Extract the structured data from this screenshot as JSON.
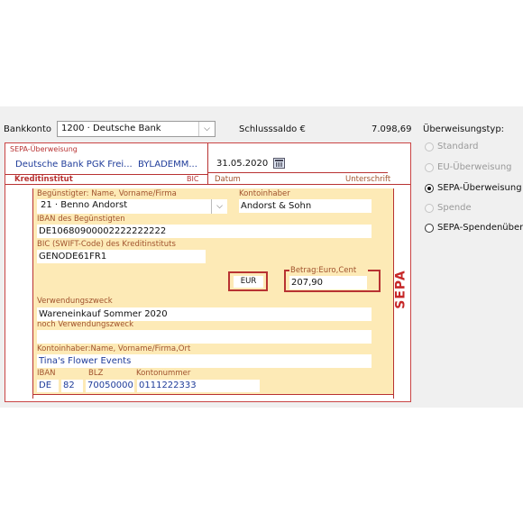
{
  "header": {
    "bankkonto_label": "Bankkonto",
    "bankkonto_value": "1200 · Deutsche Bank",
    "schlusssaldo_label": "Schlusssaldo €",
    "schlusssaldo_value": "7.098,69"
  },
  "form": {
    "sepa_title": "SEPA-Überweisung",
    "bank_name": "Deutsche Bank PGK Frei...",
    "bank_bic": "BYLADEMM...",
    "kreditinstitut_label": "Kreditinstitut",
    "bic_label": "BIC",
    "date_value": "31.05.2020",
    "datum_label": "Datum",
    "unterschrift_label": "Unterschrift",
    "beguenstigter_label": "Begünstigter: Name, Vorname/Firma",
    "beguenstigter_value": "21 · Benno Andorst",
    "kontoinhaber_label": "Kontoinhaber",
    "kontoinhaber_value": "Andorst & Sohn",
    "iban_label": "IBAN des Begünstigten",
    "iban_value": "DE10680900002222222222",
    "bic_field_label": "BIC (SWIFT-Code) des Kreditinstituts",
    "bic_value": "GENODE61FR1",
    "currency": "EUR",
    "betrag_label": "Betrag:Euro,Cent",
    "betrag_value": "207,90",
    "verwendungszweck_label": "Verwendungszweck",
    "verwendungszweck_value": "Wareneinkauf Sommer 2020",
    "noch_verwendungszweck_label": "noch Verwendungszweck",
    "noch_verwendungszweck_value": "",
    "kontoinhaber2_label": "Kontoinhaber:Name, Vorname/Firma,Ort",
    "kontoinhaber2_value": "Tina's Flower Events",
    "iban_col_label": "IBAN",
    "blz_col_label": "BLZ",
    "kontonummer_col_label": "Kontonummer",
    "iban_country": "DE",
    "iban_check": "82",
    "blz_value": "70050000",
    "kontonummer_value": "0111222333",
    "sepa_side": "SEPA"
  },
  "transfer_type": {
    "title": "Überweisungstyp:",
    "options": [
      {
        "label": "Standard",
        "selected": false,
        "enabled": false
      },
      {
        "label": "EU-Überweisung",
        "selected": false,
        "enabled": false
      },
      {
        "label": "SEPA-Überweisung",
        "selected": true,
        "enabled": true
      },
      {
        "label": "Spende",
        "selected": false,
        "enabled": false
      },
      {
        "label": "SEPA-Spendenüberw",
        "selected": false,
        "enabled": true
      }
    ]
  },
  "colors": {
    "accent_red": "#b83232",
    "form_yellow": "#fdeab6",
    "text_blue": "#1f3c9a"
  }
}
